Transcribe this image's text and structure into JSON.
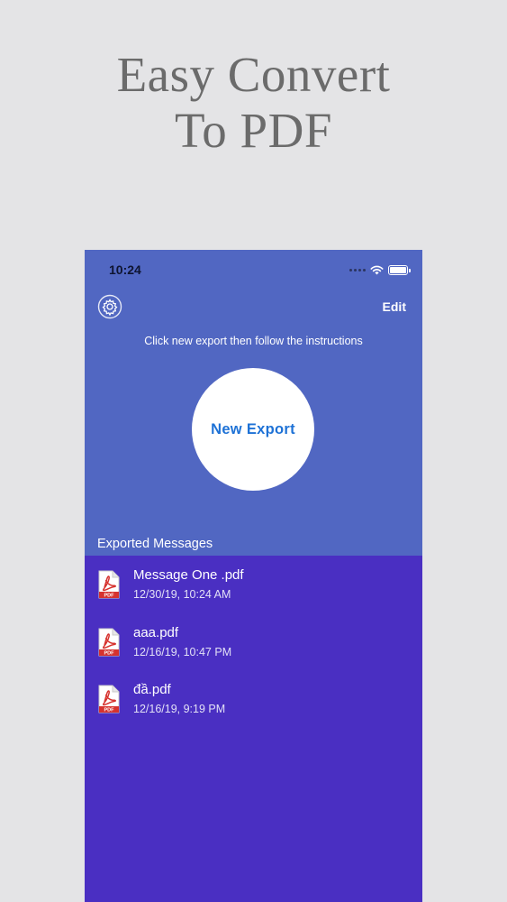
{
  "promo": {
    "headline_line1": "Easy Convert",
    "headline_line2": "To PDF"
  },
  "status_bar": {
    "time": "10:24"
  },
  "header": {
    "settings_icon": "gear-icon",
    "edit_label": "Edit",
    "instructions": "Click new export then follow the instructions"
  },
  "main": {
    "new_export_label": "New Export",
    "section_title": "Exported Messages"
  },
  "files": [
    {
      "name": "Message One .pdf",
      "date": "12/30/19, 10:24 AM",
      "icon": "pdf-file-icon"
    },
    {
      "name": "aaa.pdf",
      "date": "12/16/19, 10:47 PM",
      "icon": "pdf-file-icon"
    },
    {
      "name": "đầ.pdf",
      "date": "12/16/19, 9:19 PM",
      "icon": "pdf-file-icon"
    }
  ],
  "colors": {
    "page_background": "#e4e4e6",
    "header_blue": "#5167c2",
    "list_purple": "#4a2fc2",
    "button_text_blue": "#1e72d6",
    "pdf_red": "#d6322e"
  }
}
